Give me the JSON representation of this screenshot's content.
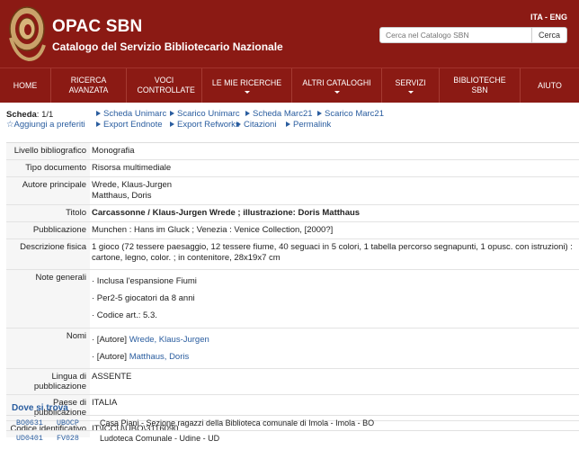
{
  "header": {
    "title": "OPAC SBN",
    "subtitle": "Catalogo del Servizio Bibliotecario Nazionale",
    "lang_ita": "ITA",
    "lang_sep": " - ",
    "lang_eng": "ENG",
    "search_placeholder": "Cerca nel Catalogo SBN",
    "search_button": "Cerca"
  },
  "nav": [
    {
      "label": "HOME",
      "dropdown": false
    },
    {
      "label": "RICERCA AVANZATA",
      "dropdown": false
    },
    {
      "label": "VOCI CONTROLLATE",
      "dropdown": false
    },
    {
      "label": "LE MIE RICERCHE",
      "dropdown": true
    },
    {
      "label": "ALTRI CATALOGHI",
      "dropdown": true
    },
    {
      "label": "SERVIZI",
      "dropdown": true
    },
    {
      "label": "BIBLIOTECHE SBN",
      "dropdown": false
    },
    {
      "label": "AIUTO",
      "dropdown": false
    }
  ],
  "toolbar": {
    "scheda_label": "Scheda",
    "scheda_value": ": 1/1",
    "aggiungi": "☆Aggiungi a preferiti",
    "links": [
      "Scheda Unimarc",
      "Scarico Unimarc",
      "Scheda Marc21",
      "Scarico Marc21",
      "Export Endnote",
      "Export Refworks",
      "Citazioni",
      "Permalink"
    ]
  },
  "record": {
    "livello_label": "Livello bibliografico",
    "livello": "Monografia",
    "tipo_label": "Tipo documento",
    "tipo": "Risorsa multimediale",
    "autore_label": "Autore principale",
    "autori": [
      "Wrede, Klaus-Jurgen",
      "Matthaus, Doris"
    ],
    "titolo_label": "Titolo",
    "titolo": "Carcassonne / Klaus-Jurgen Wrede ; illustrazione: Doris Matthaus",
    "pubblicazione_label": "Pubblicazione",
    "pubblicazione": "Munchen : Hans im Gluck ; Venezia : Venice Collection, [2000?]",
    "descrizione_label": "Descrizione fisica",
    "descrizione": "1 gioco (72 tessere paesaggio, 12 tessere fiume, 40 seguaci in 5 colori, 1 tabella percorso segnapunti, 1 opusc. con istruzioni) : cartone, legno, color. ; in contenitore, 28x19x7 cm",
    "note_label": "Note generali",
    "note": [
      "· Inclusa l'espansione Fiumi",
      "· Per2-5 giocatori da 8 anni",
      "· Codice art.: 5.3."
    ],
    "nomi_label": "Nomi",
    "nomi": [
      {
        "role": "· [Autore] ",
        "name": "Wrede, Klaus-Jurgen"
      },
      {
        "role": "· [Autore] ",
        "name": "Matthaus, Doris"
      }
    ],
    "lingua_label": "Lingua di pubblicazione",
    "lingua": "ASSENTE",
    "paese_label": "Paese di pubblicazione",
    "paese": "ITALIA",
    "codice_label": "Codice identificativo",
    "codice": "IT\\ICCU\\UBO\\3116090"
  },
  "locations": {
    "title": "Dove si trova",
    "rows": [
      {
        "code1": "BO0631",
        "code2": "UBOCP",
        "name": "Casa Piani - Sezione ragazzi della Biblioteca comunale di Imola - Imola - BO"
      },
      {
        "code1": "UD0401",
        "code2": "FV028",
        "name": "Ludoteca Comunale - Udine - UD"
      }
    ]
  },
  "colors": {
    "header_bg": "#8b1a14",
    "link": "#2a5d9f"
  }
}
